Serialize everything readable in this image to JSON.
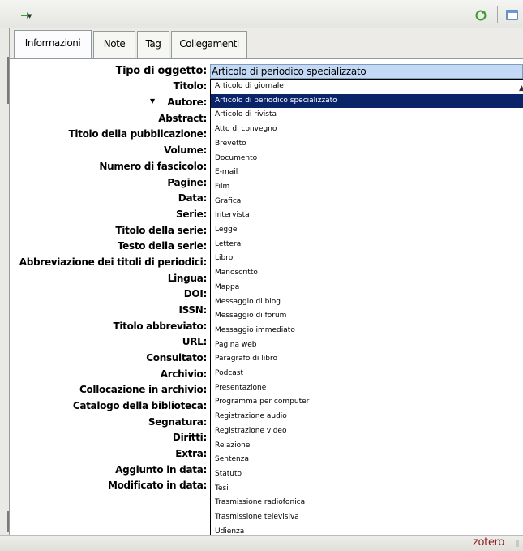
{
  "tabs": [
    {
      "label": "Informazioni"
    },
    {
      "label": "Note"
    },
    {
      "label": "Tag"
    },
    {
      "label": "Collegamenti"
    }
  ],
  "fields": [
    {
      "label": "Tipo di oggetto:"
    },
    {
      "label": "Titolo:"
    },
    {
      "label": "Autore:"
    },
    {
      "label": "Abstract:"
    },
    {
      "label": "Titolo della pubblicazione:"
    },
    {
      "label": "Volume:"
    },
    {
      "label": "Numero di fascicolo:"
    },
    {
      "label": "Pagine:"
    },
    {
      "label": "Data:"
    },
    {
      "label": "Serie:"
    },
    {
      "label": "Titolo della serie:"
    },
    {
      "label": "Testo della serie:"
    },
    {
      "label": "Abbreviazione dei titoli di periodici:"
    },
    {
      "label": "Lingua:"
    },
    {
      "label": "DOI:"
    },
    {
      "label": "ISSN:"
    },
    {
      "label": "Titolo abbreviato:"
    },
    {
      "label": "URL:"
    },
    {
      "label": "Consultato:"
    },
    {
      "label": "Archivio:"
    },
    {
      "label": "Collocazione in archivio:"
    },
    {
      "label": "Catalogo della biblioteca:"
    },
    {
      "label": "Segnatura:"
    },
    {
      "label": "Diritti:"
    },
    {
      "label": "Extra:"
    },
    {
      "label": "Aggiunto in data:"
    },
    {
      "label": "Modificato in data:"
    }
  ],
  "item_type": {
    "selected": "Articolo di periodico specializzato",
    "options": [
      "Articolo di giornale",
      "Articolo di periodico specializzato",
      "Articolo di rivista",
      "Atto di convegno",
      "Brevetto",
      "Documento",
      "E-mail",
      "Film",
      "Grafica",
      "Intervista",
      "Legge",
      "Lettera",
      "Libro",
      "Manoscritto",
      "Mappa",
      "Messaggio di blog",
      "Messaggio di forum",
      "Messaggio immediato",
      "Pagina web",
      "Paragrafo di libro",
      "Podcast",
      "Presentazione",
      "Programma per computer",
      "Registrazione audio",
      "Registrazione video",
      "Relazione",
      "Sentenza",
      "Statuto",
      "Tesi",
      "Trasmissione radiofonica",
      "Trasmissione televisiva",
      "Udienza"
    ]
  },
  "status": {
    "logo": "zotero"
  },
  "colors": {
    "selection_bg": "#0a246a",
    "combo_bg": "#c3d9f5",
    "logo": "#8b1f1f"
  },
  "icons": [
    "back-arrow-icon",
    "dropdown-arrow-icon",
    "sync-icon",
    "new-item-icon",
    "autore-expand-triangle-icon"
  ]
}
